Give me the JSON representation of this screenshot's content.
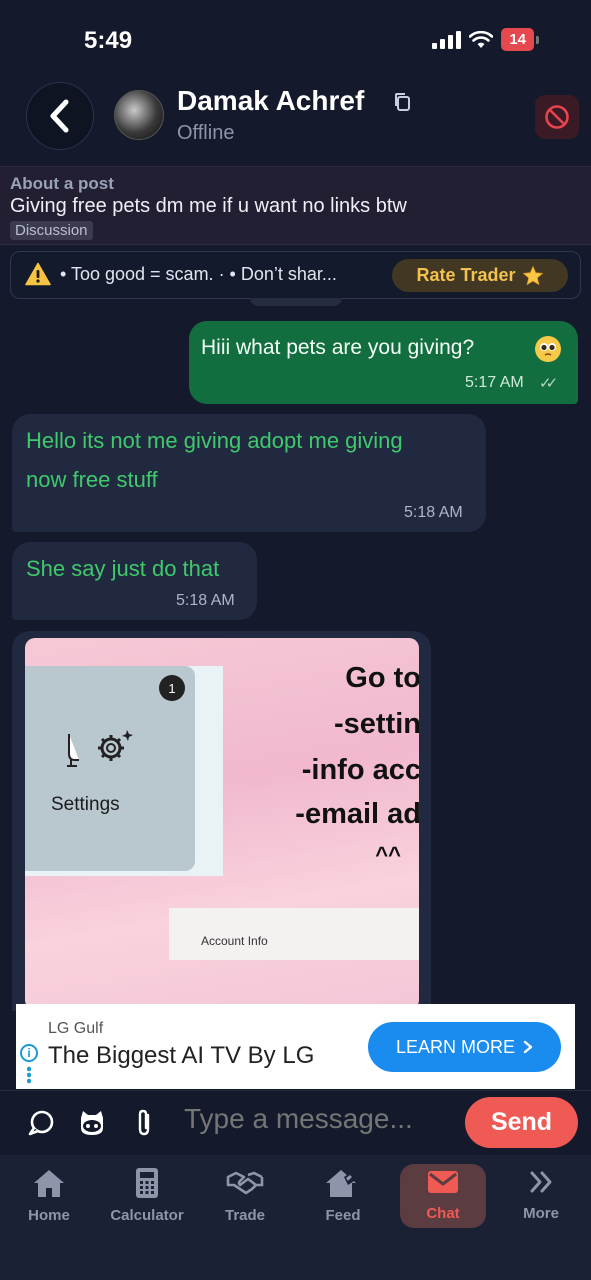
{
  "status_bar": {
    "time": "5:49",
    "battery": "14"
  },
  "header": {
    "name": "Damak Achref",
    "status": "Offline"
  },
  "post": {
    "label": "About a post",
    "text": "Giving free pets dm me if u want no links btw",
    "tag": "Discussion"
  },
  "warning": {
    "text": "• Too good = scam. · • Don’t shar...",
    "rate_label": "Rate Trader"
  },
  "messages": [
    {
      "direction": "out",
      "text": "Hiii what pets are you giving?",
      "time": "5:17 AM"
    },
    {
      "direction": "in",
      "lines": [
        "Hello its not me giving adopt me giving",
        "now free stuff"
      ],
      "time": "5:18 AM"
    },
    {
      "direction": "in",
      "text": "She say just do that",
      "time": "5:18 AM"
    },
    {
      "direction": "in",
      "type": "image",
      "image_text": {
        "badge": "1",
        "settings": "Settings",
        "lines": [
          "Go to",
          "-settin",
          "-info acc",
          "-email ad",
          "^^"
        ],
        "field": "Account Info"
      }
    }
  ],
  "ad": {
    "brand": "LG Gulf",
    "title": "The Biggest AI TV By LG",
    "cta": "LEARN MORE"
  },
  "composer": {
    "placeholder": "Type a message...",
    "send_label": "Send"
  },
  "nav": {
    "items": [
      {
        "label": "Home",
        "icon": "home-icon"
      },
      {
        "label": "Calculator",
        "icon": "calculator-icon"
      },
      {
        "label": "Trade",
        "icon": "handshake-icon"
      },
      {
        "label": "Feed",
        "icon": "feed-icon"
      },
      {
        "label": "Chat",
        "icon": "mail-icon",
        "active": true
      },
      {
        "label": "More",
        "icon": "chevrons-right-icon"
      }
    ]
  },
  "colors": {
    "background": "#141a2b",
    "outgoing_bubble": "#136e3f",
    "incoming_bubble": "#212940",
    "incoming_text": "#3fc96b",
    "accent_send": "#f05a55",
    "rate_button": "#f2c14e"
  }
}
